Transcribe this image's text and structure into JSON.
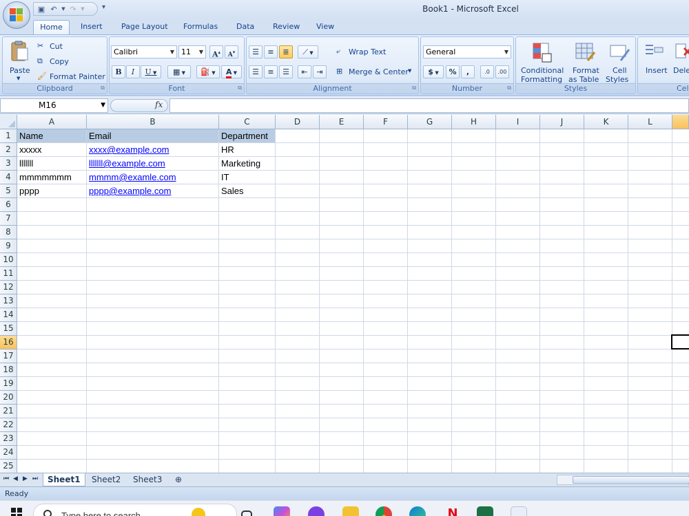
{
  "window": {
    "title": "Book1 - Microsoft Excel"
  },
  "tabs": [
    "Home",
    "Insert",
    "Page Layout",
    "Formulas",
    "Data",
    "Review",
    "View"
  ],
  "ribbon": {
    "clipboard": {
      "label": "Clipboard",
      "paste": "Paste",
      "cut": "Cut",
      "copy": "Copy",
      "format_painter": "Format Painter"
    },
    "font": {
      "label": "Font",
      "font_name": "Calibri",
      "font_size": "11",
      "bold": "B",
      "italic": "I",
      "underline": "U",
      "grow": "A",
      "shrink": "A",
      "font_color": "A"
    },
    "alignment": {
      "label": "Alignment",
      "wrap_text": "Wrap Text",
      "merge_center": "Merge & Center"
    },
    "number": {
      "label": "Number",
      "format": "General",
      "currency": "$",
      "percent": "%",
      "comma": ",",
      "inc_decimal": ".0",
      "dec_decimal": ".00"
    },
    "styles": {
      "label": "Styles",
      "conditional_1": "Conditional",
      "conditional_2": "Formatting",
      "format_table_1": "Format",
      "format_table_2": "as Table",
      "cell_styles_1": "Cell",
      "cell_styles_2": "Styles"
    },
    "cells": {
      "label": "Cell",
      "insert": "Insert",
      "delete": "Dele"
    }
  },
  "formula_bar": {
    "name_box": "M16",
    "fx": "fx",
    "formula": ""
  },
  "columns": [
    "A",
    "B",
    "C",
    "D",
    "E",
    "F",
    "G",
    "H",
    "I",
    "J",
    "K",
    "L"
  ],
  "rows": [
    "1",
    "2",
    "3",
    "4",
    "5",
    "6",
    "7",
    "8",
    "9",
    "10",
    "11",
    "12",
    "13",
    "14",
    "15",
    "16",
    "17",
    "18",
    "19",
    "20",
    "21",
    "22",
    "23",
    "24",
    "25"
  ],
  "sheet": {
    "header": [
      "Name",
      "Email",
      "Department"
    ],
    "data": [
      [
        "xxxxx",
        "xxxx@example.com",
        "HR"
      ],
      [
        "lllllll",
        "lllllll@example.com",
        "Marketing"
      ],
      [
        "mmmmmmm",
        "mmmm@examle.com",
        "IT"
      ],
      [
        "pppp",
        "pppp@example.com",
        "Sales"
      ]
    ]
  },
  "sheet_tabs": [
    "Sheet1",
    "Sheet2",
    "Sheet3"
  ],
  "status": {
    "text": "Ready"
  },
  "taskbar": {
    "search_placeholder": "Type here to search"
  },
  "colors": {
    "accent": "#15428b",
    "header_fill": "#b8cce4",
    "link": "#0000ff",
    "selected_header": "#f9c15d"
  }
}
